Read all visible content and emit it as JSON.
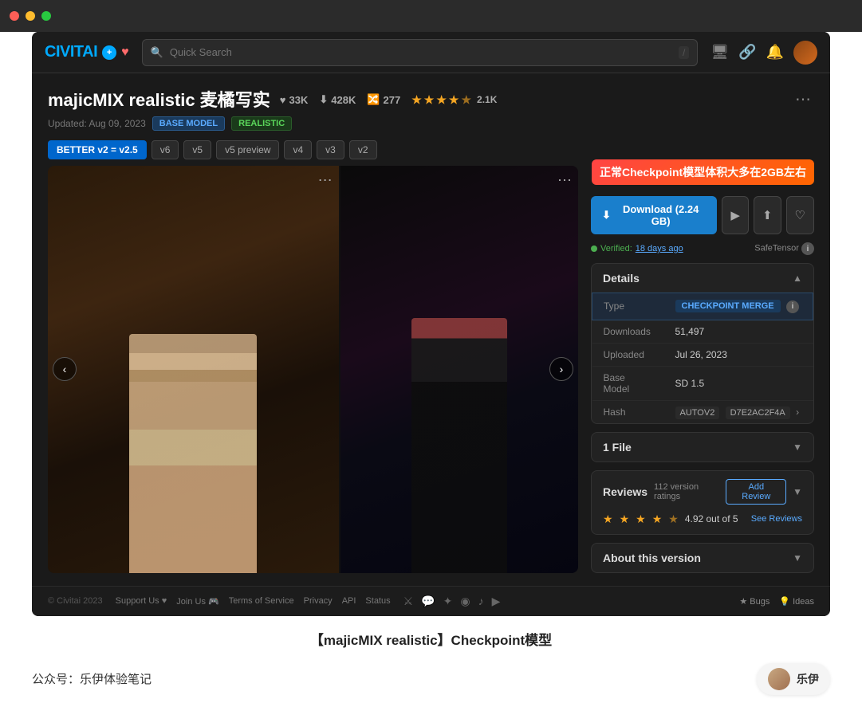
{
  "browser": {
    "dots": [
      "red",
      "yellow",
      "green"
    ]
  },
  "nav": {
    "logo": "CIVITAI",
    "logo_plus": "+",
    "search_placeholder": "Quick Search",
    "search_shortcut": "/"
  },
  "model": {
    "title": "majicMIX realistic 麦橘写实",
    "heart_count": "33K",
    "download_count": "428K",
    "remix_count": "277",
    "rating_stars": 4.5,
    "rating_count": "2.1K",
    "updated": "Updated: Aug 09, 2023",
    "badges": [
      "BASE MODEL",
      "REALISTIC"
    ],
    "versions": [
      "BETTER v2 = v2.5",
      "v6",
      "v5",
      "v5 preview",
      "v4",
      "v3",
      "v2"
    ],
    "active_version": "BETTER v2 = v2.5"
  },
  "annotation": {
    "text": "正常Checkpoint模型体积大多在2GB左右"
  },
  "download": {
    "label": "Download (2.24 GB)",
    "verified_text": "Verified:",
    "verified_date": "18 days ago",
    "safetensor_label": "SafeTensor"
  },
  "details": {
    "title": "Details",
    "type_label": "Type",
    "type_value": "CHECKPOINT MERGE",
    "downloads_label": "Downloads",
    "downloads_value": "51,497",
    "uploaded_label": "Uploaded",
    "uploaded_value": "Jul 26, 2023",
    "base_model_label": "Base Model",
    "base_model_value": "SD 1.5",
    "hash_label": "Hash",
    "hash_values": [
      "AUTOV2",
      "D7E2AC2F4A"
    ]
  },
  "files": {
    "label": "1 File"
  },
  "reviews": {
    "title": "Reviews",
    "count": "112 version ratings",
    "add_label": "Add Review",
    "see_label": "See Reviews",
    "rating_value": "4.92 out of 5"
  },
  "about": {
    "title": "About this version"
  },
  "footer": {
    "copyright": "© Civitai 2023",
    "links": [
      "Support Us ♥",
      "Join Us 🎮",
      "Terms of Service",
      "Privacy",
      "API",
      "Status"
    ],
    "bugs_label": "★ Bugs",
    "ideas_label": "💡 Ideas"
  },
  "caption": {
    "text": "【majicMIX realistic】Checkpoint模型"
  },
  "author": {
    "label": "公众号：乐伊体验笔记",
    "name": "乐伊"
  }
}
